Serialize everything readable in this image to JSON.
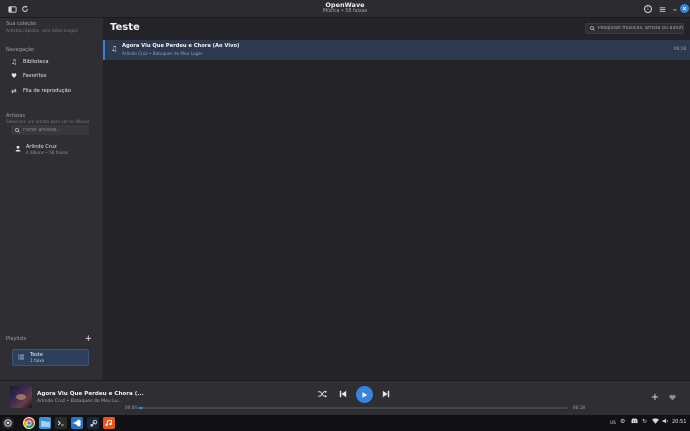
{
  "header": {
    "title": "OpenWave",
    "subtitle": "Música • 58 faixas",
    "icons": [
      "library-icon",
      "refresh-icon",
      "info-icon",
      "menu-icon",
      "minimize-icon",
      "close-icon"
    ]
  },
  "sidebar": {
    "collection_label": "Sua coleção",
    "collection_hint": "Artistas rápidos, com listas longas",
    "navigation_label": "Navegação",
    "nav_items": [
      {
        "label": "Biblioteca",
        "icon": "music-note-icon"
      },
      {
        "label": "Favoritos",
        "icon": "heart-icon"
      },
      {
        "label": "Fila de reprodução",
        "icon": "queue-icon"
      }
    ],
    "artists_label": "Artistas",
    "artists_hint": "Selecione um artista para ver os álbuns",
    "filter_placeholder": "Filtrar artistas...",
    "artist": {
      "name": "Arlindo Cruz",
      "meta": "4 álbuns • 58 faixas"
    },
    "playlists_label": "Playlists",
    "playlist": {
      "name": "Teste",
      "count": "1 faixa"
    }
  },
  "main": {
    "title": "Teste",
    "search_placeholder": "Pesquisar músicas, artista ou álbum...",
    "tracks": [
      {
        "title": "Agora Viu Que Perdeu e Chora (Ao Vivo)",
        "subtitle": "Arlindo Cruz • Batuques do Meu Lugar",
        "duration": "06:18"
      }
    ]
  },
  "player": {
    "title": "Agora Viu Que Perdeu e Chora (...",
    "subtitle": "Arlindo Cruz • Batuques do Meu Lu...",
    "elapsed": "00:04",
    "total": "06:18",
    "progress": 0.011
  },
  "taskbar": {
    "lang": "US",
    "clock": "20:51"
  },
  "colors": {
    "accent": "#3584e4",
    "sidebar_bg": "#2e2e33",
    "main_bg": "#242428",
    "selected_row": "#2d3a4e"
  }
}
